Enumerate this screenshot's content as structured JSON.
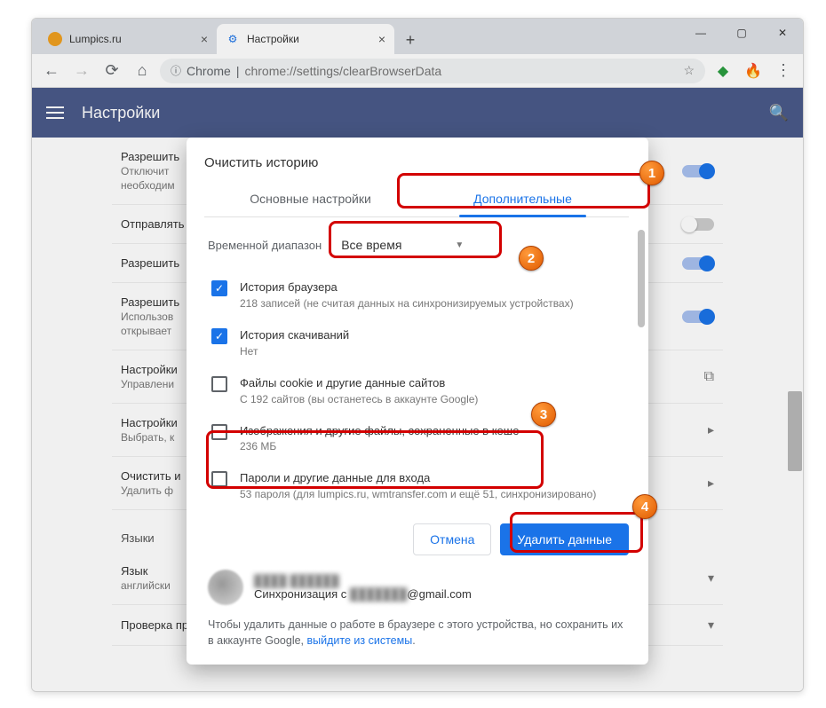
{
  "window": {
    "tabs": [
      {
        "title": "Lumpics.ru",
        "favicon_color": "#f0a020"
      },
      {
        "title": "Настройки",
        "favicon_color": "#1a73e8"
      }
    ]
  },
  "toolbar": {
    "chrome_label": "Chrome",
    "url_separator": " | ",
    "url_path": "chrome://settings/clearBrowserData"
  },
  "settings_header": {
    "title": "Настройки"
  },
  "bg_rows": {
    "r0_title": "Разрешить",
    "r0_sub": "Отключит",
    "r0_sub2": "необходим",
    "r1_title": "Отправлять",
    "r2_title": "Разрешить",
    "r3_title": "Разрешить",
    "r3_sub": "Использов",
    "r3_sub2": "открывает",
    "r4_title": "Настройки",
    "r4_sub": "Управлени",
    "r5_title": "Настройки",
    "r5_sub": "Выбрать, к",
    "r6_title": "Очистить и",
    "r6_sub": "Удалить ф",
    "lang_section": "Языки",
    "lang_row_title": "Язык",
    "lang_row_sub": "английски",
    "spell_row": "Проверка правописания"
  },
  "dialog": {
    "title": "Очистить историю",
    "tab_basic": "Основные настройки",
    "tab_advanced": "Дополнительные",
    "range_label": "Временной диапазон",
    "range_value": "Все время",
    "items": [
      {
        "title": "История браузера",
        "sub": "218 записей (не считая данных на синхронизируемых устройствах)",
        "checked": true
      },
      {
        "title": "История скачиваний",
        "sub": "Нет",
        "checked": true
      },
      {
        "title": "Файлы cookie и другие данные сайтов",
        "sub": "С 192 сайтов (вы останетесь в аккаунте Google)",
        "checked": false
      },
      {
        "title": "Изображения и другие файлы, сохраненные в кеше",
        "sub": "236 МБ",
        "checked": false
      },
      {
        "title": "Пароли и другие данные для входа",
        "sub": "53 пароля (для lumpics.ru, wmtransfer.com и ещё 51, синхронизировано)",
        "checked": false
      }
    ],
    "cancel": "Отмена",
    "confirm": "Удалить данные",
    "sync_prefix": "Синхронизация с ",
    "sync_email_suffix": "@gmail.com",
    "footer_text": "Чтобы удалить данные о работе в браузере с этого устройства, но сохранить их в аккаунте Google, ",
    "footer_link": "выйдите из системы",
    "footer_period": "."
  },
  "badges": {
    "b1": "1",
    "b2": "2",
    "b3": "3",
    "b4": "4"
  }
}
